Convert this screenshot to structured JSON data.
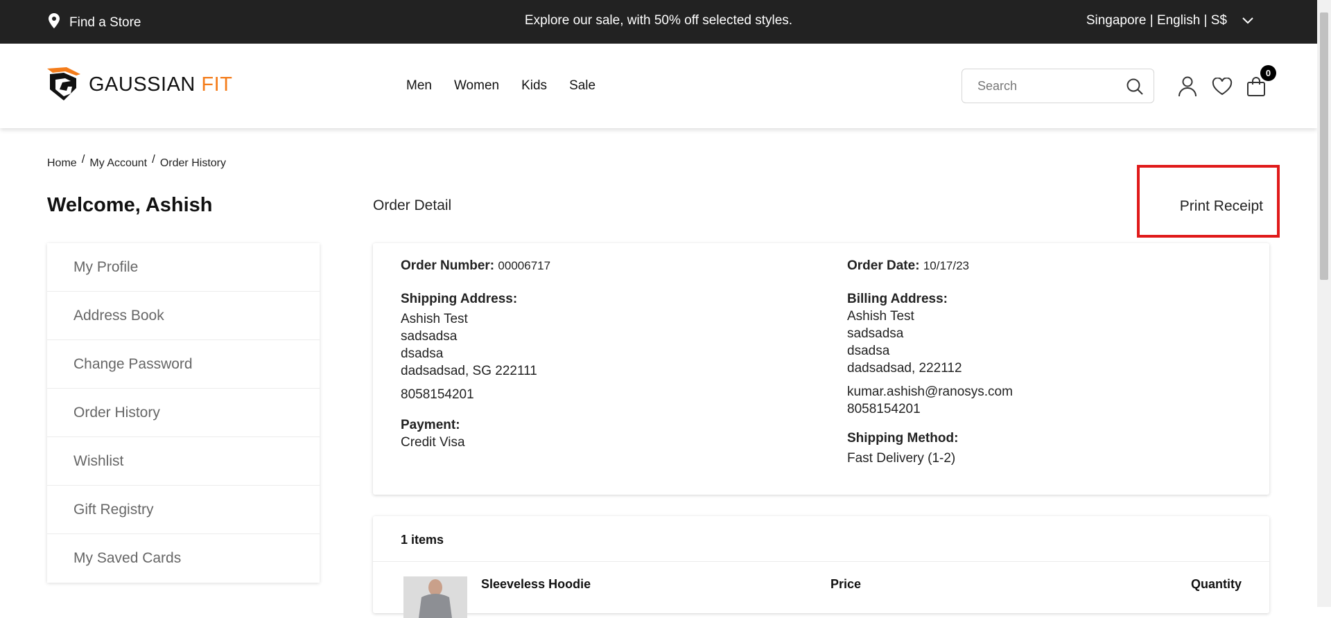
{
  "topbar": {
    "store_label": "Find a Store",
    "promo": "Explore our sale, with 50% off selected styles.",
    "locale": "Singapore | English | S$"
  },
  "brand": {
    "name_part1": "GAUSSIAN",
    "name_part2": " FIT",
    "accent": "#f47c1a"
  },
  "nav": [
    "Men",
    "Women",
    "Kids",
    "Sale"
  ],
  "search": {
    "placeholder": "Search"
  },
  "cart": {
    "count": "0"
  },
  "breadcrumb": [
    "Home",
    "My Account",
    "Order History"
  ],
  "welcome": "Welcome, Ashish",
  "sidebar": [
    "My Profile",
    "Address Book",
    "Change Password",
    "Order History",
    "Wishlist",
    "Gift Registry",
    "My Saved Cards"
  ],
  "order": {
    "title": "Order Detail",
    "print_label": "Print Receipt",
    "number_label": "Order Number:",
    "number": "00006717",
    "date_label": "Order Date:",
    "date": "10/17/23",
    "shipping_label": "Shipping Address:",
    "shipping": [
      "Ashish Test",
      "sadsadsa",
      "dsadsa",
      "dadsadsad, SG 222111"
    ],
    "shipping_phone": "8058154201",
    "billing_label": "Billing Address:",
    "billing": [
      "Ashish Test",
      "sadsadsa",
      "dsadsa",
      "dadsadsad, 222112"
    ],
    "billing_email": "kumar.ashish@ranosys.com",
    "billing_phone": "8058154201",
    "payment_label": "Payment:",
    "payment": "Credit Visa",
    "method_label": "Shipping Method:",
    "method": "Fast Delivery (1-2)"
  },
  "items": {
    "count_label": "1 items",
    "product_name": "Sleeveless Hoodie",
    "price_header": "Price",
    "quantity_header": "Quantity"
  },
  "colors": {
    "topbar": "#222222",
    "highlight": "#e01a1a"
  }
}
